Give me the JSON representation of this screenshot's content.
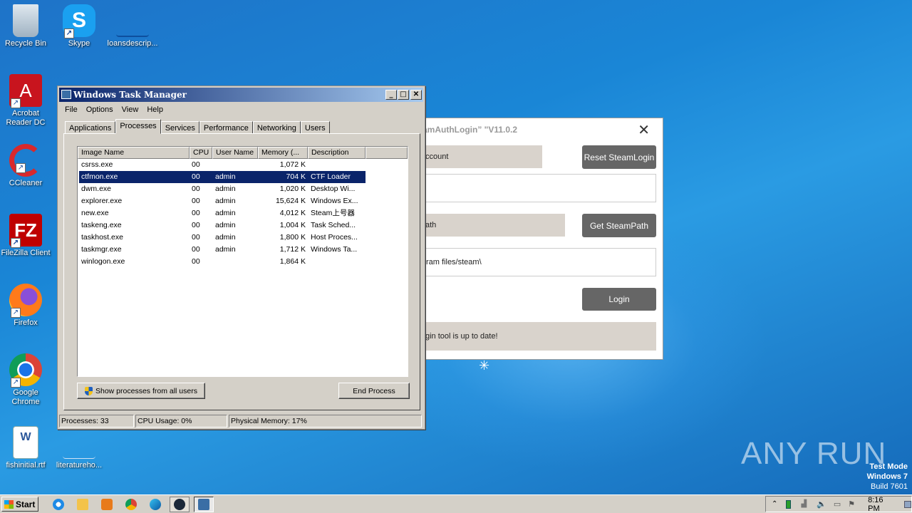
{
  "desktop": {
    "icons": [
      {
        "label": "Recycle Bin"
      },
      {
        "label": "Skype"
      },
      {
        "label": "loansdescrip..."
      },
      {
        "label": "Acrobat Reader DC"
      },
      {
        "label": "CCleaner"
      },
      {
        "label": "FileZilla Client"
      },
      {
        "label": "Firefox"
      },
      {
        "label": "Google Chrome"
      },
      {
        "label": "fishinitial.rtf"
      },
      {
        "label": "literatureho..."
      }
    ],
    "watermark": {
      "line1": "Test Mode",
      "line2": "Windows 7",
      "line3": "Build 7601"
    },
    "brand": "ANY RUN"
  },
  "steam_window": {
    "title": "amAuthLogin” \"V11.0.2",
    "close": "✕",
    "account_label": "ccount",
    "reset_button": "Reset SteamLogin",
    "path_label": "ath",
    "get_path_button": "Get SteamPath",
    "path_value": "ram files/steam\\",
    "login_button": "Login",
    "status_text": "gin tool is up to date!"
  },
  "task_manager": {
    "title": "Windows Task Manager",
    "menu": [
      "File",
      "Options",
      "View",
      "Help"
    ],
    "tabs": [
      "Applications",
      "Processes",
      "Services",
      "Performance",
      "Networking",
      "Users"
    ],
    "active_tab": "Processes",
    "columns": [
      "Image Name",
      "CPU",
      "User Name",
      "Memory (...",
      "Description"
    ],
    "processes": [
      {
        "name": "csrss.exe",
        "cpu": "00",
        "user": "",
        "memory": "1,072 K",
        "desc": ""
      },
      {
        "name": "ctfmon.exe",
        "cpu": "00",
        "user": "admin",
        "memory": "704 K",
        "desc": "CTF Loader"
      },
      {
        "name": "dwm.exe",
        "cpu": "00",
        "user": "admin",
        "memory": "1,020 K",
        "desc": "Desktop Wi..."
      },
      {
        "name": "explorer.exe",
        "cpu": "00",
        "user": "admin",
        "memory": "15,624 K",
        "desc": "Windows Ex..."
      },
      {
        "name": "new.exe",
        "cpu": "00",
        "user": "admin",
        "memory": "4,012 K",
        "desc": "Steam上号器"
      },
      {
        "name": "taskeng.exe",
        "cpu": "00",
        "user": "admin",
        "memory": "1,004 K",
        "desc": "Task Sched..."
      },
      {
        "name": "taskhost.exe",
        "cpu": "00",
        "user": "admin",
        "memory": "1,800 K",
        "desc": "Host Proces..."
      },
      {
        "name": "taskmgr.exe",
        "cpu": "00",
        "user": "admin",
        "memory": "1,712 K",
        "desc": "Windows Ta..."
      },
      {
        "name": "winlogon.exe",
        "cpu": "00",
        "user": "",
        "memory": "1,864 K",
        "desc": ""
      }
    ],
    "selected_row": 1,
    "show_all_button": "Show processes from all users",
    "end_process_button": "End Process",
    "status": {
      "processes": "Processes: 33",
      "cpu": "CPU Usage: 0%",
      "memory": "Physical Memory: 17%"
    }
  },
  "taskbar": {
    "start_label": "Start",
    "clock": "8:16 PM"
  }
}
